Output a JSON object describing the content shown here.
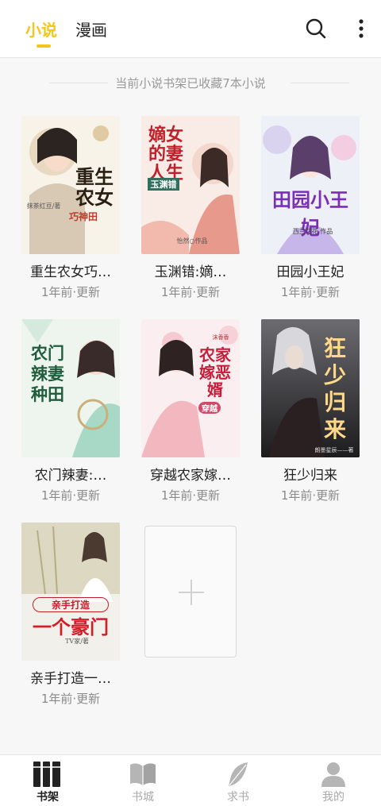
{
  "header": {
    "tabs": [
      {
        "label": "小说",
        "active": true
      },
      {
        "label": "漫画",
        "active": false
      }
    ],
    "search_icon": "search-icon",
    "more_icon": "more-vertical-icon",
    "accent_color": "#f5c518"
  },
  "summary": "当前小说书架已收藏7本小说",
  "books": [
    {
      "title": "重生农女巧…",
      "status": "1年前·更新",
      "cover_text": "重生农女",
      "cover_sub": "巧神田",
      "cover_author": "抹茶红豆/著"
    },
    {
      "title": "玉渊错:嫡…",
      "status": "1年前·更新",
      "cover_text": "嫡女的妻人生",
      "cover_sub": "玉渊错",
      "cover_author": "怡然○作品"
    },
    {
      "title": "田园小王妃",
      "status": "1年前·更新",
      "cover_text": "田园小王妃",
      "cover_sub": "",
      "cover_author": "西兰花花 作品"
    },
    {
      "title": "农门辣妻:…",
      "status": "1年前·更新",
      "cover_text": "农门辣妻 种田",
      "cover_sub": "",
      "cover_author": ""
    },
    {
      "title": "穿越农家嫁…",
      "status": "1年前·更新",
      "cover_text": "农家嫁恶婿",
      "cover_sub": "穿越",
      "cover_author": "沫香香"
    },
    {
      "title": "狂少归来",
      "status": "1年前·更新",
      "cover_text": "狂少归来",
      "cover_sub": "",
      "cover_author": "朗墨星辰——著"
    },
    {
      "title": "亲手打造一…",
      "status": "1年前·更新",
      "cover_text": "一个豪门",
      "cover_sub": "亲手打造",
      "cover_author": "TV家/著"
    }
  ],
  "add_book_icon": "plus-icon",
  "nav": [
    {
      "label": "书架",
      "icon": "bookshelf-icon",
      "active": true
    },
    {
      "label": "书城",
      "icon": "open-book-icon",
      "active": false
    },
    {
      "label": "求书",
      "icon": "feather-icon",
      "active": false
    },
    {
      "label": "我的",
      "icon": "user-icon",
      "active": false
    }
  ]
}
